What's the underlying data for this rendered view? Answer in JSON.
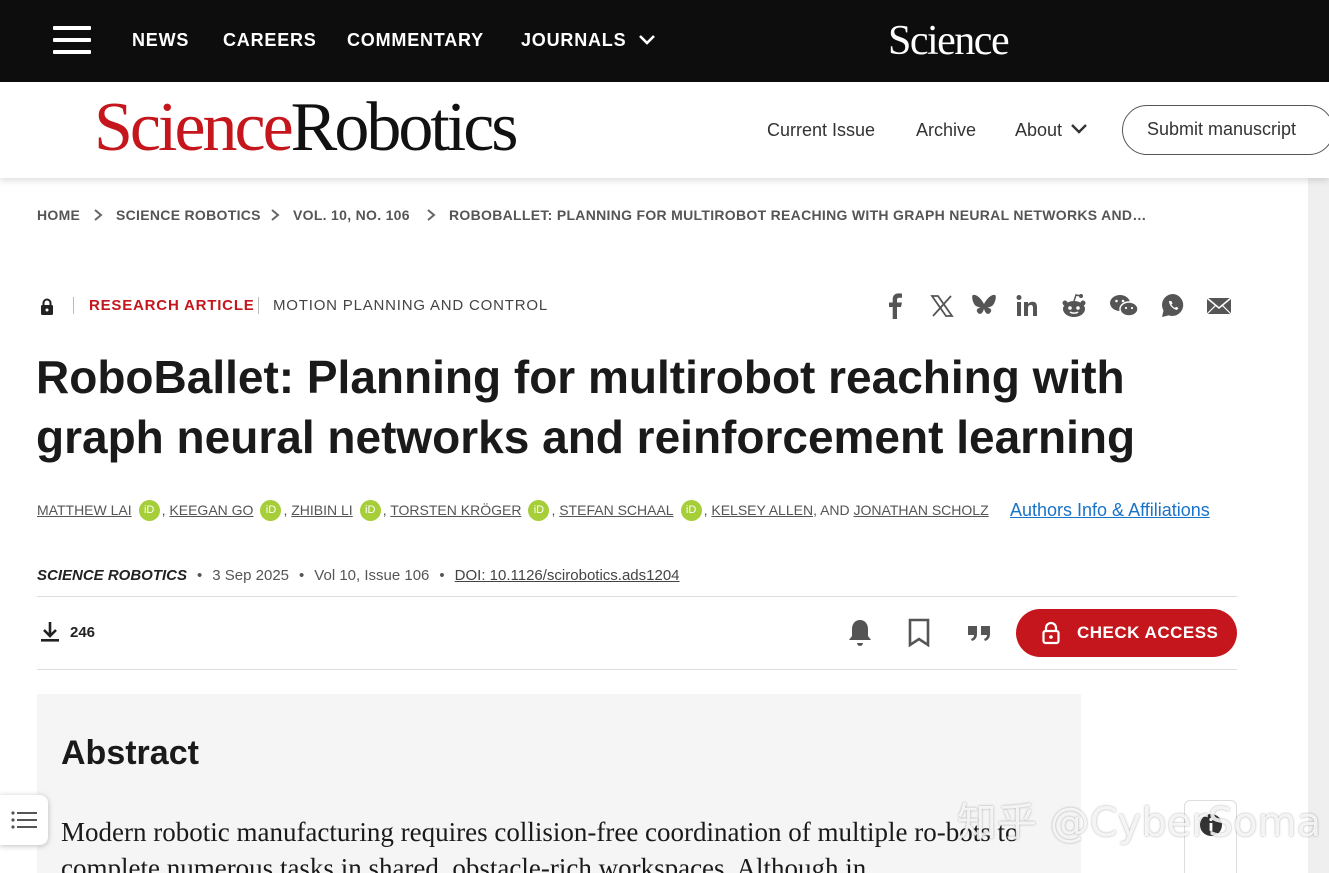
{
  "topbar": {
    "nav": [
      "NEWS",
      "CAREERS",
      "COMMENTARY",
      "JOURNALS"
    ],
    "logo": "Science"
  },
  "brand": {
    "part1": "Science",
    "part2": "Robotics"
  },
  "subnav": {
    "current_issue": "Current Issue",
    "archive": "Archive",
    "about": "About",
    "submit": "Submit manuscript"
  },
  "breadcrumb": [
    "HOME",
    "SCIENCE ROBOTICS",
    "VOL. 10, NO. 106",
    "ROBOBALLET: PLANNING FOR MULTIROBOT REACHING WITH GRAPH NEURAL NETWORKS AND…"
  ],
  "article": {
    "type": "RESEARCH ARTICLE",
    "subject": "MOTION PLANNING AND CONTROL",
    "title": "RoboBallet: Planning for multirobot reaching with graph neural networks and reinforcement learning",
    "authors": [
      "MATTHEW LAI",
      "KEEGAN GO",
      "ZHIBIN LI",
      "TORSTEN KRÖGER",
      "STEFAN SCHAAL",
      "KELSEY ALLEN",
      "JONATHAN SCHOLZ"
    ],
    "and_text": ", AND",
    "affiliations_link": "Authors Info & Affiliations",
    "journal": "SCIENCE ROBOTICS",
    "date": "3 Sep 2025",
    "volume": "Vol 10, Issue 106",
    "doi": "DOI: 10.1126/scirobotics.ads1204",
    "downloads": "246",
    "check_access": "CHECK ACCESS"
  },
  "share_icons": [
    "facebook-icon",
    "x-icon",
    "bluesky-icon",
    "linkedin-icon",
    "reddit-icon",
    "wechat-icon",
    "whatsapp-icon",
    "email-icon"
  ],
  "abstract": {
    "heading": "Abstract",
    "text": "Modern robotic manufacturing requires collision-free coordination of multiple ro-bots to complete numerous tasks in shared, obstacle-rich workspaces. Although in"
  },
  "watermark": "知乎 @CyberSoma",
  "colors": {
    "brand_red": "#c4161c",
    "topbar": "#0d0d0d",
    "orcid_green": "#a6ce39",
    "link_blue": "#1a73c8"
  }
}
